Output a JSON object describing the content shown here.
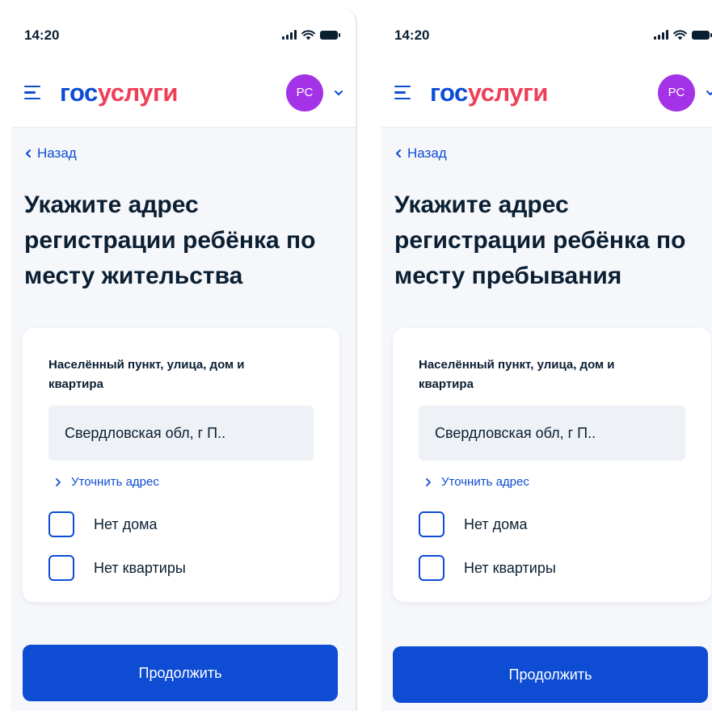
{
  "screens": [
    {
      "status": {
        "time": "14:20"
      },
      "header": {
        "logo_part1": "гос",
        "logo_part2": "услуги",
        "avatar_initials": "РС"
      },
      "back_label": "Назад",
      "title": "Укажите адрес регистрации ребёнка по месту жительства",
      "form": {
        "field_label": "Населённый пункт, улица, дом и квартира",
        "address_value": "Свердловская обл, г П..",
        "clarify_label": "Уточнить адрес",
        "checkbox_no_house": "Нет дома",
        "checkbox_no_apartment": "Нет квартиры"
      },
      "continue_label": "Продолжить"
    },
    {
      "status": {
        "time": "14:20"
      },
      "header": {
        "logo_part1": "гос",
        "logo_part2": "услуги",
        "avatar_initials": "РС"
      },
      "back_label": "Назад",
      "title": "Укажите адрес регистрации ребёнка по месту пребывания",
      "form": {
        "field_label": "Населённый пункт, улица, дом и квартира",
        "address_value": "Свердловская обл, г П..",
        "clarify_label": "Уточнить адрес",
        "checkbox_no_house": "Нет дома",
        "checkbox_no_apartment": "Нет квартиры"
      },
      "continue_label": "Продолжить"
    }
  ],
  "icons": {
    "menu": "menu-icon",
    "chevron_down": "chevron-down-icon",
    "chevron_left": "chevron-left-icon",
    "chevron_right": "chevron-right-icon",
    "signal": "cellular-signal-icon",
    "wifi": "wifi-icon",
    "battery": "battery-icon"
  },
  "colors": {
    "brand_blue": "#0d4cd3",
    "brand_red": "#ee3f58",
    "avatar_purple": "#a432e6",
    "text_dark": "#0b1f33",
    "page_bg": "#f5f7fa",
    "input_bg": "#eef1f5"
  }
}
